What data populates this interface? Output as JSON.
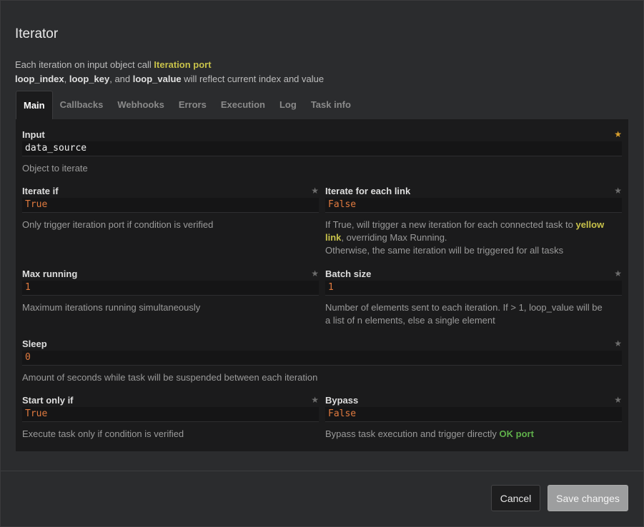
{
  "dialog": {
    "title": "Iterator",
    "desc_line1_prefix": "Each iteration on input object call ",
    "desc_line1_highlight": "Iteration port",
    "desc_line2_k1": "loop_index",
    "desc_line2_sep1": ", ",
    "desc_line2_k2": "loop_key",
    "desc_line2_sep2": ", and ",
    "desc_line2_k3": "loop_value",
    "desc_line2_suffix": " will reflect current index and value"
  },
  "tabs": [
    {
      "label": "Main",
      "active": true
    },
    {
      "label": "Callbacks"
    },
    {
      "label": "Webhooks"
    },
    {
      "label": "Errors"
    },
    {
      "label": "Execution"
    },
    {
      "label": "Log"
    },
    {
      "label": "Task info"
    }
  ],
  "fields": {
    "input": {
      "label": "Input",
      "value": "data_source",
      "help": "Object to iterate",
      "required": true
    },
    "iterate_if": {
      "label": "Iterate if",
      "value": "True",
      "help": "Only trigger iteration port if condition is verified"
    },
    "iterate_each_link": {
      "label": "Iterate for each link",
      "value": "False",
      "help_prefix": "If True, will trigger a new iteration for each connected task to ",
      "help_highlight_1": "yellow",
      "help_highlight_2": "link",
      "help_mid": ", overriding Max Running.",
      "help_line3": "Otherwise, the same iteration will be triggered for all tasks"
    },
    "max_running": {
      "label": "Max running",
      "value": "1",
      "help": "Maximum iterations running simultaneously"
    },
    "batch_size": {
      "label": "Batch size",
      "value": "1",
      "help_line1": "Number of elements sent to each iteration. If > 1, loop_value will be",
      "help_line2": "a list of n elements, else a single element"
    },
    "sleep": {
      "label": "Sleep",
      "value": "0",
      "help": "Amount of seconds while task will be suspended between each iteration"
    },
    "start_only_if": {
      "label": "Start only if",
      "value": "True",
      "help": "Execute task only if condition is verified"
    },
    "bypass": {
      "label": "Bypass",
      "value": "False",
      "help_prefix": "Bypass task execution and trigger directly ",
      "help_highlight": "OK port"
    }
  },
  "icons": {
    "star": "★"
  },
  "footer": {
    "cancel_label": "Cancel",
    "save_label": "Save changes"
  },
  "colors": {
    "accent_yellow": "#c8c24a",
    "accent_green": "#5fb04a",
    "value_orange": "#e07a3f",
    "required_star": "#d9a02e"
  }
}
